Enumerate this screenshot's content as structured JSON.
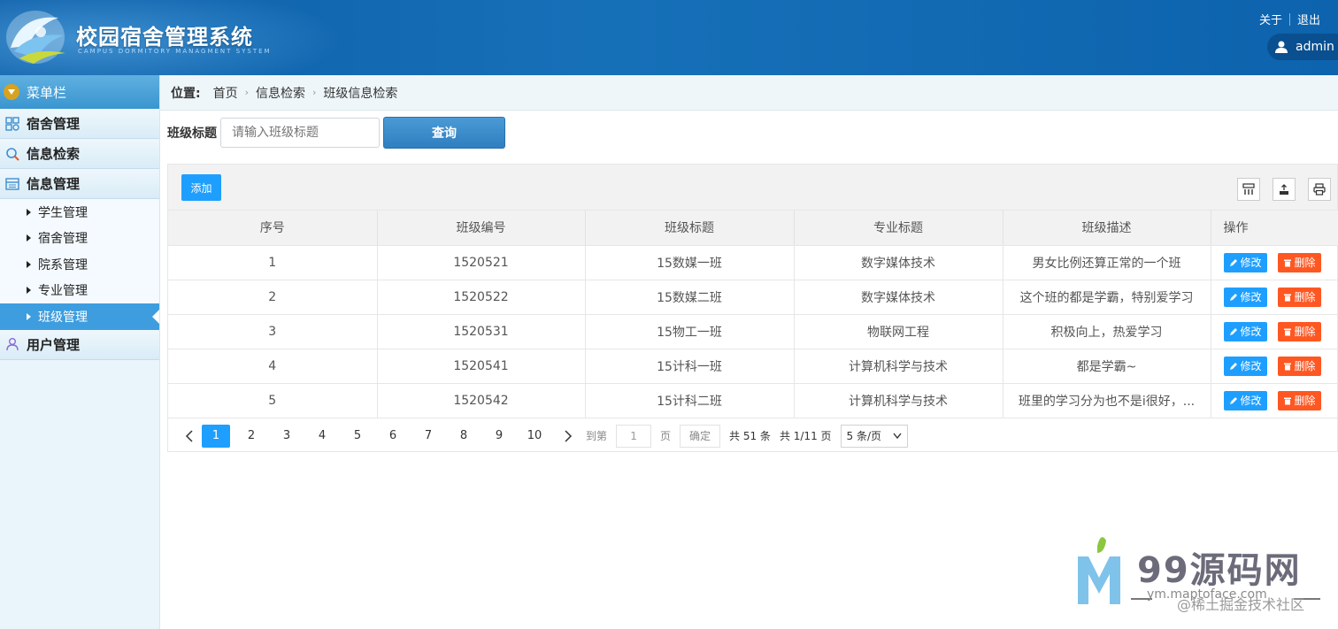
{
  "header": {
    "title": "校园宿舍管理系统",
    "subtitle": "CAMPUS DORMITORY MANAGMENT SYSTEM",
    "about": "关于",
    "logout": "退出",
    "user": "admin"
  },
  "sidebar": {
    "head": "菜单栏",
    "groups": [
      {
        "label": "宿舍管理"
      },
      {
        "label": "信息检索"
      },
      {
        "label": "信息管理"
      }
    ],
    "sub_items": [
      "学生管理",
      "宿舍管理",
      "院系管理",
      "专业管理",
      "班级管理"
    ],
    "last_group": "用户管理"
  },
  "breadcrumb": {
    "label": "位置:",
    "items": [
      "首页",
      "信息检索",
      "班级信息检索"
    ]
  },
  "search": {
    "label": "班级标题",
    "placeholder": "请输入班级标题",
    "button": "查询"
  },
  "toolbar": {
    "add": "添加"
  },
  "table": {
    "headers": [
      "序号",
      "班级编号",
      "班级标题",
      "专业标题",
      "班级描述",
      "操作"
    ],
    "rows": [
      {
        "no": "1",
        "code": "1520521",
        "title": "15数媒一班",
        "major": "数字媒体技术",
        "desc": "男女比例还算正常的一个班"
      },
      {
        "no": "2",
        "code": "1520522",
        "title": "15数媒二班",
        "major": "数字媒体技术",
        "desc": "这个班的都是学霸，特别爱学习"
      },
      {
        "no": "3",
        "code": "1520531",
        "title": "15物工一班",
        "major": "物联网工程",
        "desc": "积极向上，热爱学习"
      },
      {
        "no": "4",
        "code": "1520541",
        "title": "15计科一班",
        "major": "计算机科学与技术",
        "desc": "都是学霸~"
      },
      {
        "no": "5",
        "code": "1520542",
        "title": "15计科二班",
        "major": "计算机科学与技术",
        "desc": "班里的学习分为也不是i很好，..."
      }
    ],
    "edit_label": "修改",
    "delete_label": "删除"
  },
  "pager": {
    "pages": [
      "1",
      "2",
      "3",
      "4",
      "5",
      "6",
      "7",
      "8",
      "9",
      "10"
    ],
    "current": "1",
    "goto_label": "到第",
    "goto_value": "1",
    "page_unit": "页",
    "confirm": "确定",
    "total": "共 51 条",
    "page_count": "共 1/11 页",
    "page_size": "5 条/页"
  },
  "watermark": {
    "brand": "99源码网",
    "url": "ym.maptoface.com",
    "credit": "@稀土掘金技术社区"
  },
  "colors": {
    "header_blue": "#0e5fa8",
    "primary": "#1e9fff",
    "danger": "#ff5722",
    "active_menu": "#3d9ddf"
  }
}
